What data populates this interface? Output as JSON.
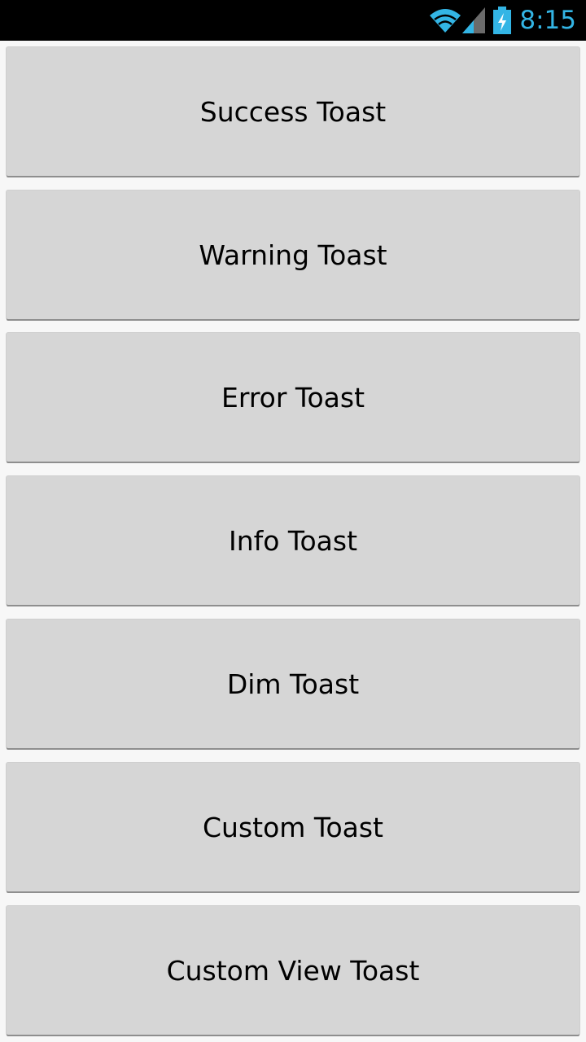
{
  "status_bar": {
    "time": "8:15",
    "icons": [
      "wifi-icon",
      "cell-signal-icon",
      "battery-charging-icon"
    ],
    "accent_color": "#33b5e5"
  },
  "buttons": [
    {
      "label": "Success Toast"
    },
    {
      "label": "Warning Toast"
    },
    {
      "label": "Error Toast"
    },
    {
      "label": "Info Toast"
    },
    {
      "label": "Dim Toast"
    },
    {
      "label": "Custom Toast"
    },
    {
      "label": "Custom View Toast"
    }
  ]
}
